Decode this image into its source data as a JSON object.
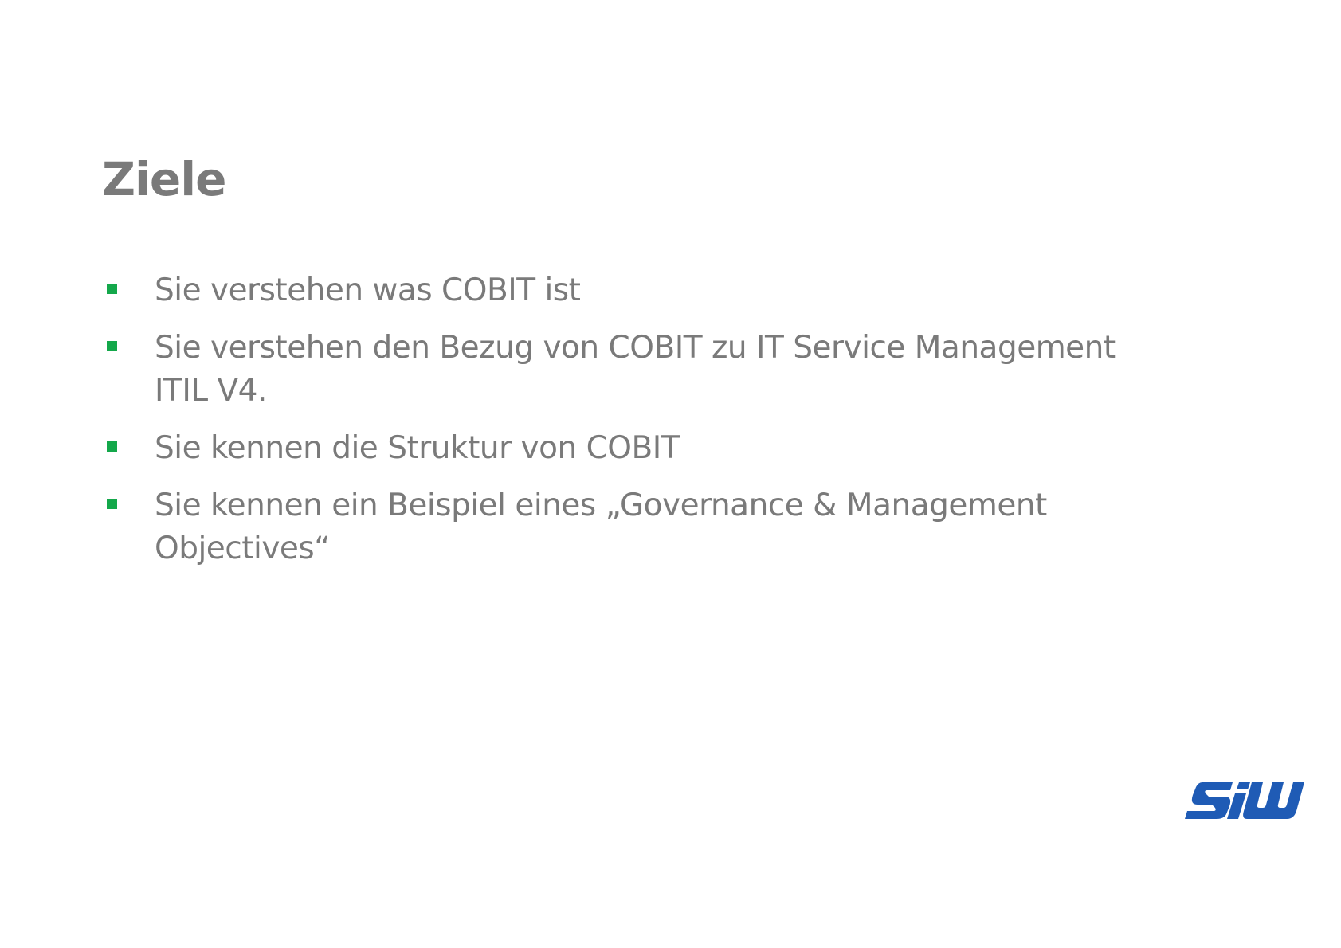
{
  "slide": {
    "title": "Ziele",
    "bullets": [
      {
        "text": "Sie verstehen was COBIT ist"
      },
      {
        "text": "Sie verstehen den Bezug von COBIT zu IT Service Management ITIL V4."
      },
      {
        "text": "Sie kennen die Struktur von COBIT"
      },
      {
        "text": "Sie kennen ein Beispiel eines „Governance & Management Objectives“"
      }
    ],
    "logo": {
      "text": "SIW",
      "icon": "siw-logo-icon",
      "color": "#1f5bb5"
    },
    "colors": {
      "text": "#7a7a7a",
      "bullet": "#14a84b",
      "background": "#ffffff"
    }
  }
}
